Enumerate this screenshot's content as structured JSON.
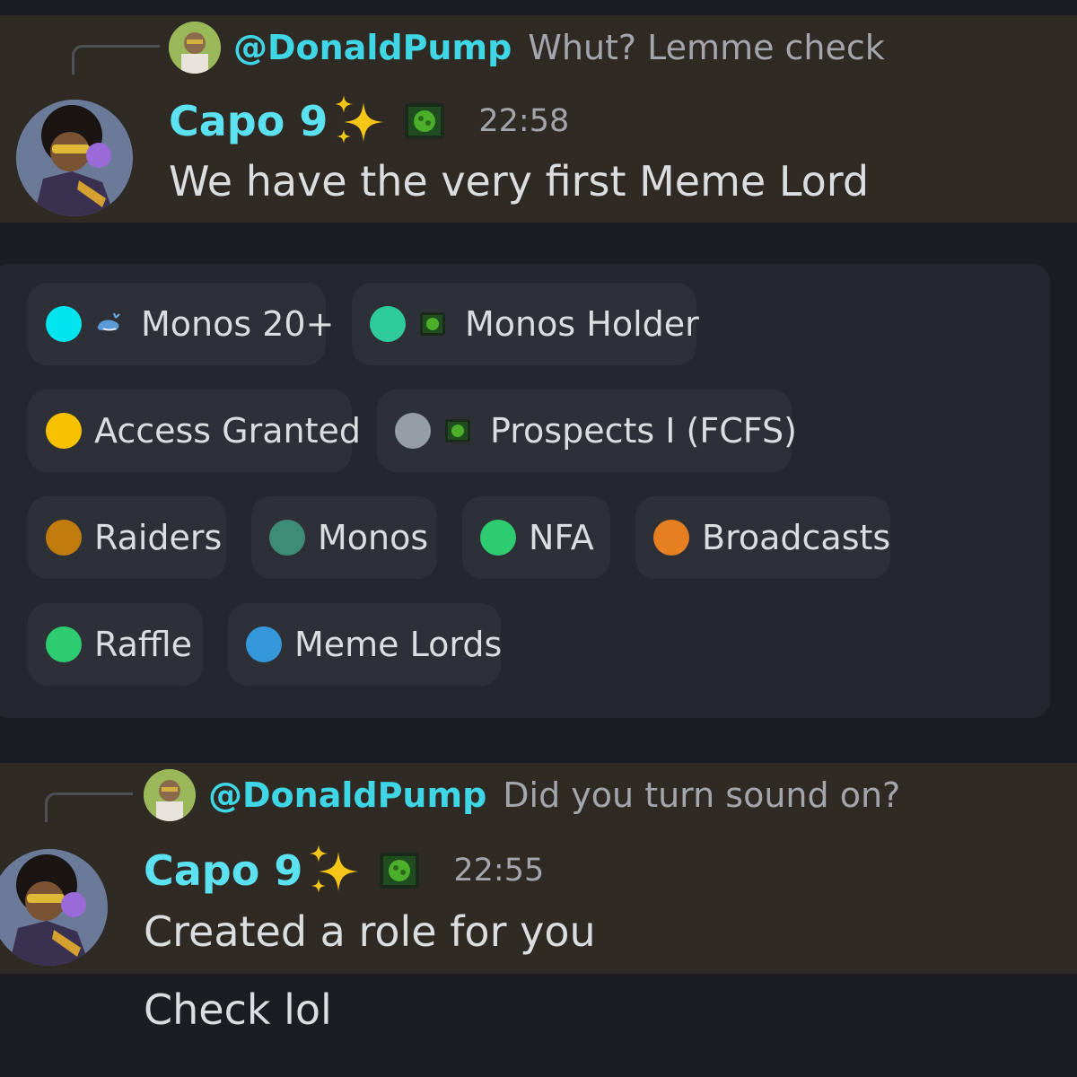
{
  "messages": [
    {
      "reply": {
        "mention": "@DonaldPump",
        "text": "Whut? Lemme check"
      },
      "author": "Capo 9",
      "timestamp": "22:58",
      "content": "We have the very first Meme Lord"
    },
    {
      "reply": {
        "mention": "@DonaldPump",
        "text": "Did you turn sound on?"
      },
      "author": "Capo 9",
      "timestamp": "22:55",
      "content": "Created a role for you",
      "followup": "Check lol"
    }
  ],
  "roles": [
    {
      "label": "Monos 20+",
      "color": "#00e5f0",
      "icon": "whale-icon"
    },
    {
      "label": "Monos Holder",
      "color": "#2ecc9a",
      "icon": "monos-icon"
    },
    {
      "label": "Access Granted",
      "color": "#f9c200",
      "icon": ""
    },
    {
      "label": "Prospects I (FCFS)",
      "color": "#959fa3",
      "icon": "monos-icon"
    },
    {
      "label": "Raiders",
      "color": "#c27c0e",
      "icon": ""
    },
    {
      "label": "Monos",
      "color": "#3d8c74",
      "icon": ""
    },
    {
      "label": "NFA",
      "color": "#2ecc71",
      "icon": ""
    },
    {
      "label": "Broadcasts",
      "color": "#e67e22",
      "icon": ""
    },
    {
      "label": "Raffle",
      "color": "#2ecc71",
      "icon": ""
    },
    {
      "label": "Meme Lords",
      "color": "#3498db",
      "icon": ""
    }
  ],
  "theme": {
    "mention_color": "#3fd6e6",
    "author_color": "#5ce1f0",
    "highlight_bg": "#2f2a24"
  }
}
